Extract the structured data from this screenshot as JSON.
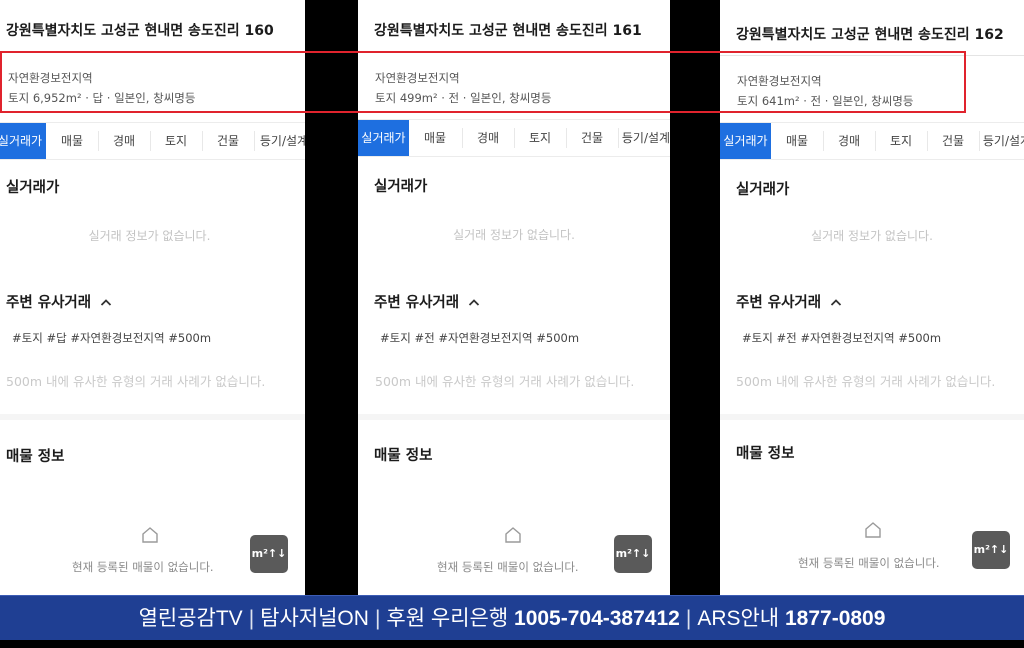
{
  "panels": [
    {
      "address": "강원특별자치도 고성군 현내면 송도진리 160",
      "zone": "자연환경보전지역",
      "land_info": "토지 6,952m² · 답 · 일본인, 창씨명등",
      "tabs": [
        "실거래가",
        "매물",
        "경매",
        "토지",
        "건물",
        "등기/설계"
      ],
      "active_tab": "실거래가",
      "real_price_title": "실거래가",
      "real_price_empty": "실거래 정보가 없습니다.",
      "nearby_title": "주변 유사거래",
      "nearby_tags": "#토지 #답 #자연환경보전지역 #500m",
      "nearby_empty": "500m 내에 유사한 유형의 거래 사례가 없습니다.",
      "listing_title": "매물 정보",
      "listing_empty": "현재 등록된 매물이 없습니다.",
      "unit_button": "m²↑↓"
    },
    {
      "address": "강원특별자치도 고성군 현내면 송도진리 161",
      "zone": "자연환경보전지역",
      "land_info": "토지 499m² · 전 · 일본인, 창씨명등",
      "tabs": [
        "실거래가",
        "매물",
        "경매",
        "토지",
        "건물",
        "등기/설계"
      ],
      "active_tab": "실거래가",
      "real_price_title": "실거래가",
      "real_price_empty": "실거래 정보가 없습니다.",
      "nearby_title": "주변 유사거래",
      "nearby_tags": "#토지 #전 #자연환경보전지역 #500m",
      "nearby_empty": "500m 내에 유사한 유형의 거래 사례가 없습니다.",
      "listing_title": "매물 정보",
      "listing_empty": "현재 등록된 매물이 없습니다.",
      "unit_button": "m²↑↓"
    },
    {
      "address": "강원특별자치도 고성군 현내면 송도진리 162",
      "zone": "자연환경보전지역",
      "land_info": "토지 641m² · 전 · 일본인, 창씨명등",
      "tabs": [
        "실거래가",
        "매물",
        "경매",
        "토지",
        "건물",
        "등기/설계"
      ],
      "active_tab": "실거래가",
      "real_price_title": "실거래가",
      "real_price_empty": "실거래 정보가 없습니다.",
      "nearby_title": "주변 유사거래",
      "nearby_tags": "#토지 #전 #자연환경보전지역 #500m",
      "nearby_empty": "500m 내에 유사한 유형의 거래 사례가 없습니다.",
      "listing_title": "매물 정보",
      "listing_empty": "현재 등록된 매물이 없습니다.",
      "unit_button": "m²↑↓"
    }
  ],
  "banner": {
    "channel1": "열린공감TV",
    "channel2": "탐사저널ON",
    "sponsor_label": "후원 우리은행",
    "account": "1005-704-387412",
    "ars_label": "ARS안내",
    "ars_number": "1877-0809"
  },
  "colors": {
    "active_tab": "#1e6fe0",
    "highlight_box": "#e0232d",
    "banner_bg": "#1f3f93"
  }
}
